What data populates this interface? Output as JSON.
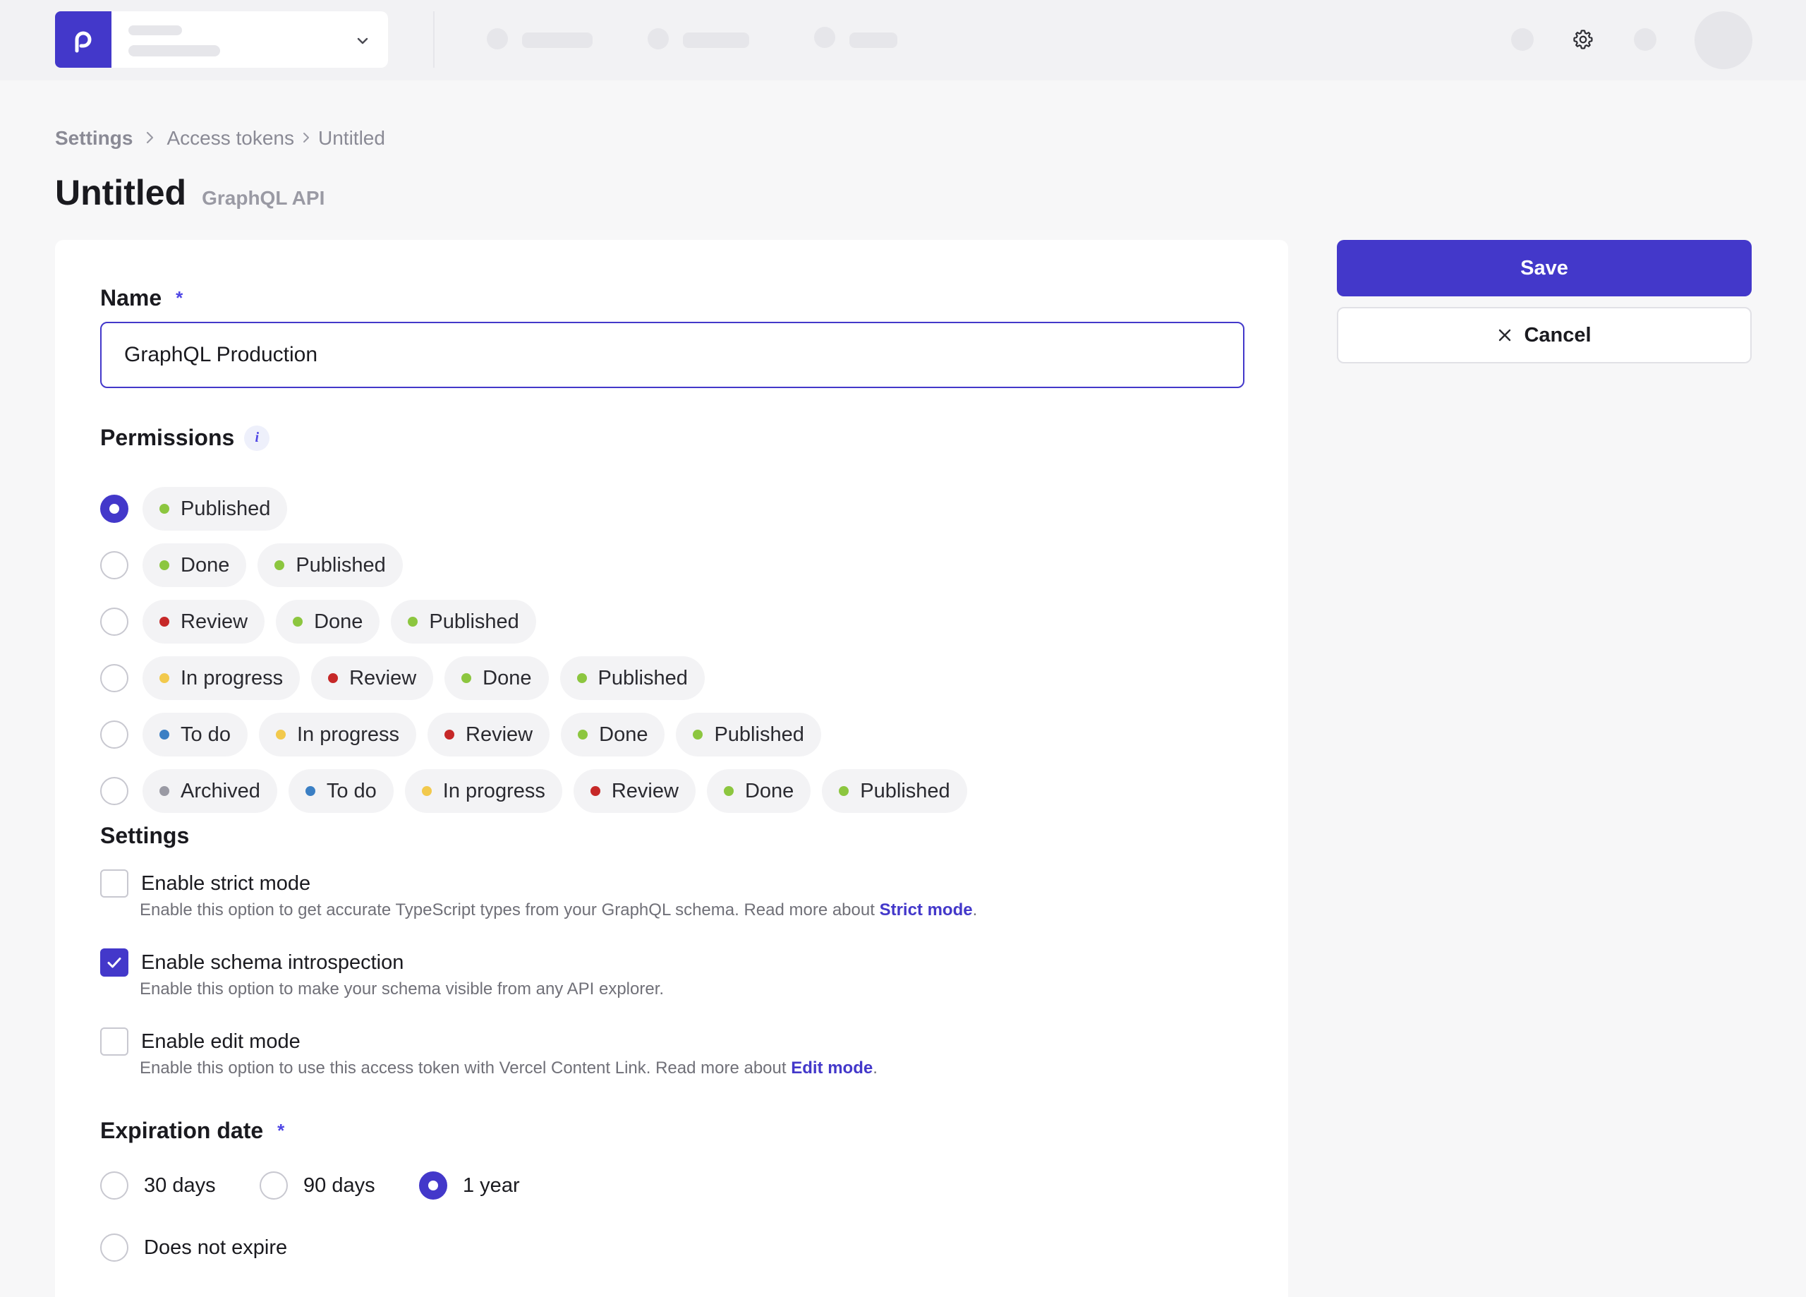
{
  "breadcrumb": [
    "Settings",
    "Access tokens",
    "Untitled"
  ],
  "page": {
    "title": "Untitled",
    "subtitle": "GraphQL API"
  },
  "name_field": {
    "label": "Name",
    "required_marker": "*",
    "value": "GraphQL Production"
  },
  "permissions": {
    "label": "Permissions",
    "info_icon": "i",
    "selected_index": 0,
    "options": [
      [
        {
          "label": "Published",
          "color": "#8cc63f"
        }
      ],
      [
        {
          "label": "Done",
          "color": "#8cc63f"
        },
        {
          "label": "Published",
          "color": "#8cc63f"
        }
      ],
      [
        {
          "label": "Review",
          "color": "#c62828"
        },
        {
          "label": "Done",
          "color": "#8cc63f"
        },
        {
          "label": "Published",
          "color": "#8cc63f"
        }
      ],
      [
        {
          "label": "In progress",
          "color": "#f2c94c"
        },
        {
          "label": "Review",
          "color": "#c62828"
        },
        {
          "label": "Done",
          "color": "#8cc63f"
        },
        {
          "label": "Published",
          "color": "#8cc63f"
        }
      ],
      [
        {
          "label": "To do",
          "color": "#3b7fc4"
        },
        {
          "label": "In progress",
          "color": "#f2c94c"
        },
        {
          "label": "Review",
          "color": "#c62828"
        },
        {
          "label": "Done",
          "color": "#8cc63f"
        },
        {
          "label": "Published",
          "color": "#8cc63f"
        }
      ],
      [
        {
          "label": "Archived",
          "color": "#9a9aa4"
        },
        {
          "label": "To do",
          "color": "#3b7fc4"
        },
        {
          "label": "In progress",
          "color": "#f2c94c"
        },
        {
          "label": "Review",
          "color": "#c62828"
        },
        {
          "label": "Done",
          "color": "#8cc63f"
        },
        {
          "label": "Published",
          "color": "#8cc63f"
        }
      ]
    ]
  },
  "settings": {
    "label": "Settings",
    "strict_mode": {
      "label": "Enable strict mode",
      "checked": false,
      "help": "Enable this option to get accurate TypeScript types from your GraphQL schema. Read more about ",
      "link": "Strict mode",
      "help_end": "."
    },
    "introspection": {
      "label": "Enable schema introspection",
      "checked": true,
      "help": "Enable this option to make your schema visible from any API explorer."
    },
    "edit_mode": {
      "label": "Enable edit mode",
      "checked": false,
      "help": "Enable this option to use this access token with Vercel Content Link. Read more about ",
      "link": "Edit mode",
      "help_end": "."
    }
  },
  "expiration": {
    "label": "Expiration date",
    "required_marker": "*",
    "options": [
      "30 days",
      "90 days",
      "1 year",
      "Does not expire"
    ],
    "selected": "1 year"
  },
  "actions": {
    "save_label": "Save",
    "cancel_label": "Cancel"
  },
  "colors": {
    "accent": "#4338ca",
    "background": "#f7f7f8"
  },
  "icons": {
    "logo": "p-logo-icon",
    "dropdown": "chevron-down-icon",
    "settings": "gear-icon",
    "cancel": "close-icon",
    "check": "check-icon"
  }
}
